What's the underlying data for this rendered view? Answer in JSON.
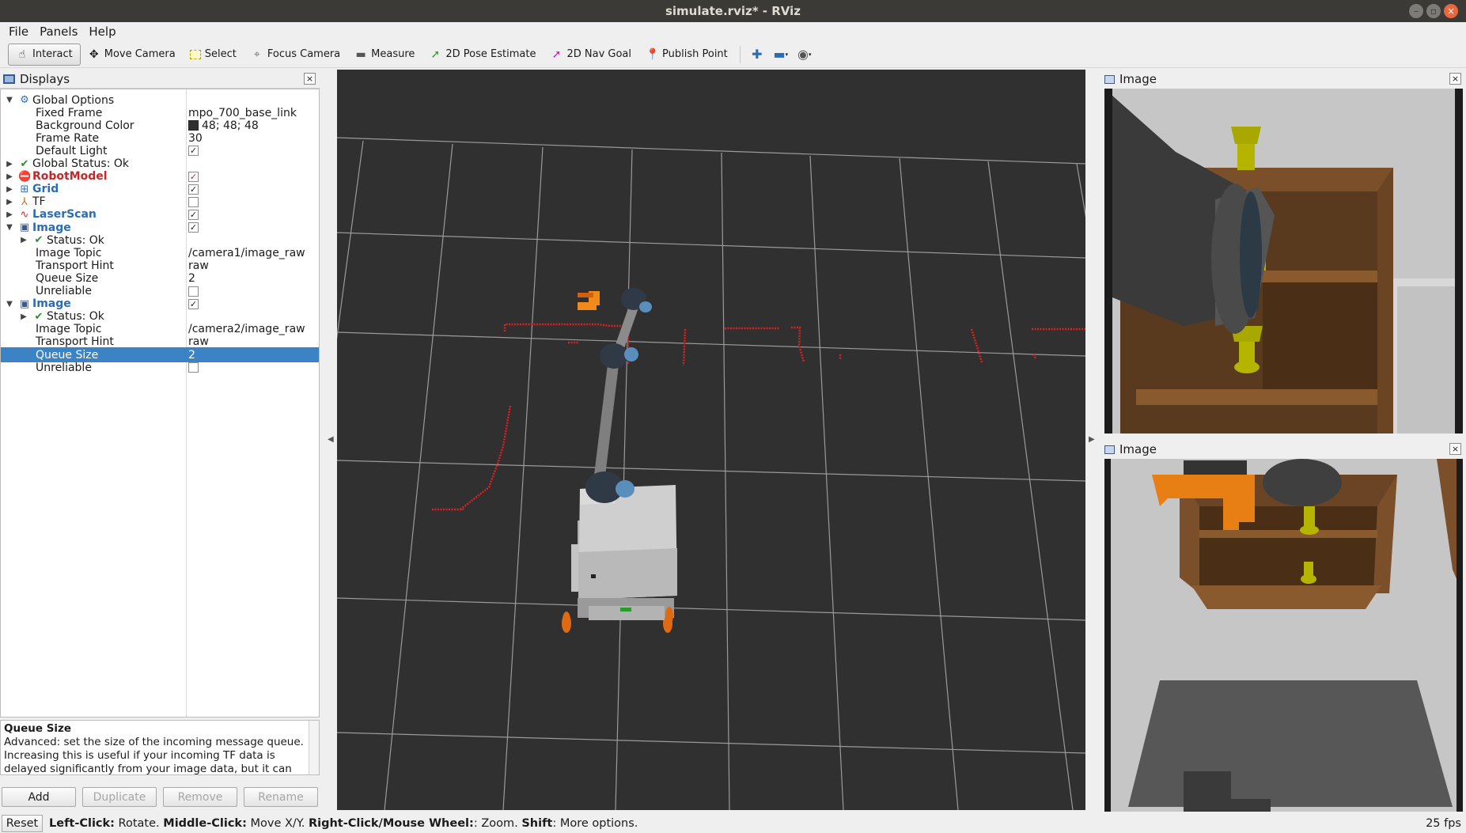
{
  "window": {
    "title": "simulate.rviz* - RViz"
  },
  "menu": [
    "File",
    "Panels",
    "Help"
  ],
  "toolbar": {
    "tools": [
      {
        "label": "Interact",
        "icon": "hand-cursor-icon",
        "active": true
      },
      {
        "label": "Move Camera",
        "icon": "move-camera-icon"
      },
      {
        "label": "Select",
        "icon": "select-rectangle-icon"
      },
      {
        "label": "Focus Camera",
        "icon": "focus-camera-icon"
      },
      {
        "label": "Measure",
        "icon": "ruler-icon"
      },
      {
        "label": "2D Pose Estimate",
        "icon": "green-arrow-icon"
      },
      {
        "label": "2D Nav Goal",
        "icon": "magenta-arrow-icon"
      },
      {
        "label": "Publish Point",
        "icon": "map-pin-icon"
      }
    ],
    "extra": [
      "plus-icon",
      "minus-icon",
      "eye-icon"
    ]
  },
  "displays": {
    "title": "Displays",
    "rows": [
      {
        "depth": 0,
        "arrow": "down",
        "icon": "gear-icon",
        "label": "Global Options",
        "style": ""
      },
      {
        "depth": 1,
        "label": "Fixed Frame",
        "value": "mpo_700_base_link"
      },
      {
        "depth": 1,
        "label": "Background Color",
        "value": "48; 48; 48",
        "swatch": true
      },
      {
        "depth": 1,
        "label": "Frame Rate",
        "value": "30"
      },
      {
        "depth": 1,
        "label": "Default Light",
        "check": true
      },
      {
        "depth": 0,
        "arrow": "right",
        "icon": "check-icon",
        "label": "Global Status: Ok"
      },
      {
        "depth": 0,
        "arrow": "right",
        "icon": "error-icon",
        "label": "RobotModel",
        "style": "red",
        "check": true
      },
      {
        "depth": 0,
        "arrow": "right",
        "icon": "grid-icon",
        "label": "Grid",
        "style": "blue",
        "check": true
      },
      {
        "depth": 0,
        "arrow": "right",
        "icon": "tf-axes-icon",
        "label": "TF",
        "check": false
      },
      {
        "depth": 0,
        "arrow": "right",
        "icon": "laser-scan-icon",
        "label": "LaserScan",
        "style": "blue",
        "check": true
      },
      {
        "depth": 0,
        "arrow": "down",
        "icon": "image-icon",
        "label": "Image",
        "style": "blue",
        "check": true
      },
      {
        "depth": 1,
        "arrow": "right",
        "icon": "check-icon",
        "label": "Status: Ok"
      },
      {
        "depth": 1,
        "label": "Image Topic",
        "value": "/camera1/image_raw"
      },
      {
        "depth": 1,
        "label": "Transport Hint",
        "value": "raw"
      },
      {
        "depth": 1,
        "label": "Queue Size",
        "value": "2"
      },
      {
        "depth": 1,
        "label": "Unreliable",
        "check": false
      },
      {
        "depth": 0,
        "arrow": "down",
        "icon": "image-icon",
        "label": "Image",
        "style": "blue",
        "check": true
      },
      {
        "depth": 1,
        "arrow": "right",
        "icon": "check-icon",
        "label": "Status: Ok"
      },
      {
        "depth": 1,
        "label": "Image Topic",
        "value": "/camera2/image_raw"
      },
      {
        "depth": 1,
        "label": "Transport Hint",
        "value": "raw"
      },
      {
        "depth": 1,
        "label": "Queue Size",
        "value": "2",
        "selected": true
      },
      {
        "depth": 1,
        "label": "Unreliable",
        "check": false
      }
    ],
    "help_title": "Queue Size",
    "help_text": "Advanced: set the size of the incoming message queue. Increasing this is useful if your incoming TF data is delayed significantly from your image data, but it can",
    "buttons": [
      {
        "label": "Add",
        "enabled": true
      },
      {
        "label": "Duplicate",
        "enabled": false
      },
      {
        "label": "Remove",
        "enabled": false
      },
      {
        "label": "Rename",
        "enabled": false
      }
    ]
  },
  "image_panels": [
    {
      "title": "Image"
    },
    {
      "title": "Image"
    }
  ],
  "status": {
    "reset": "Reset",
    "hint_parts": [
      {
        "b": "Left-Click:",
        "t": " Rotate. "
      },
      {
        "b": "Middle-Click:",
        "t": " Move X/Y. "
      },
      {
        "b": "Right-Click/Mouse Wheel:",
        "t": ": Zoom. "
      },
      {
        "b": "Shift",
        "t": ": More options."
      }
    ],
    "fps": "25 fps"
  },
  "colors": {
    "background": "#303030",
    "grid": "#a0a0a0",
    "laser": "#e02020",
    "selection": "#3b83c4"
  }
}
